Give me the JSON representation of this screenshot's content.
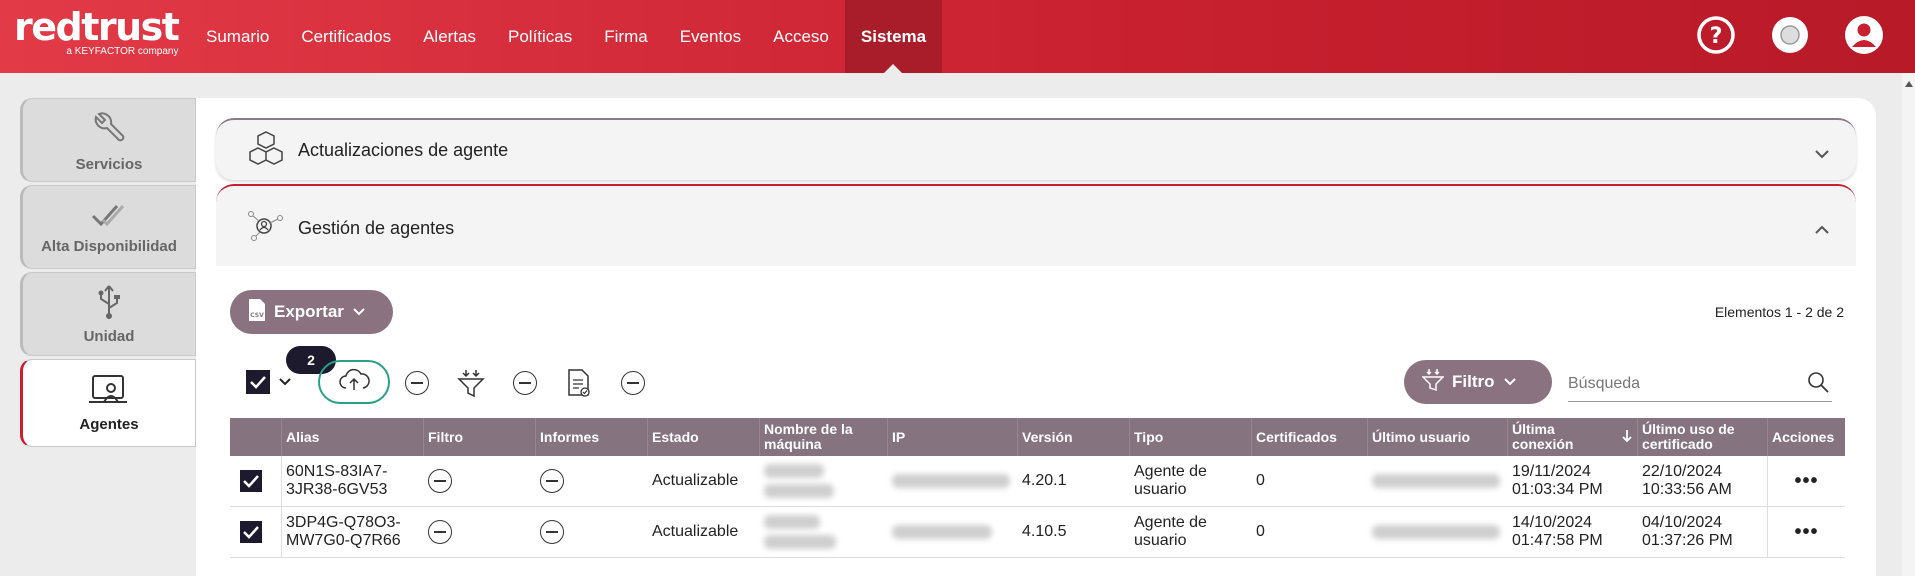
{
  "brand": {
    "name": "redtrust",
    "sub": "a KEYFACTOR company"
  },
  "nav": {
    "items": [
      "Sumario",
      "Certificados",
      "Alertas",
      "Políticas",
      "Firma",
      "Eventos",
      "Acceso",
      "Sistema"
    ],
    "active": "Sistema"
  },
  "top_icons": [
    "help-icon",
    "status-dot-icon",
    "user-icon"
  ],
  "sidebar": {
    "items": [
      {
        "label": "Servicios",
        "icon": "wrench-icon"
      },
      {
        "label": "Alta Disponibilidad",
        "icon": "double-check-icon"
      },
      {
        "label": "Unidad",
        "icon": "usb-icon"
      },
      {
        "label": "Agentes",
        "icon": "agent-monitor-icon",
        "active": true
      }
    ]
  },
  "accordions": {
    "updates": {
      "title": "Actualizaciones de agente"
    },
    "management": {
      "title": "Gestión de agentes"
    }
  },
  "toolbar": {
    "export_label": "Exportar",
    "elements_text": "Elementos 1 - 2 de 2",
    "selected_count": "2",
    "filter_label": "Filtro",
    "search_placeholder": "Búsqueda"
  },
  "table": {
    "headers": [
      "Alias",
      "Filtro",
      "Informes",
      "Estado",
      "Nombre de la máquina",
      "IP",
      "Versión",
      "Tipo",
      "Certificados",
      "Último usuario",
      "Última conexión",
      "Último uso de certificado",
      "Acciones"
    ],
    "rows": [
      {
        "alias": "60N1S-83IA7-3JR38-6GV53",
        "estado": "Actualizable",
        "version": "4.20.1",
        "tipo": "Agente de usuario",
        "certificados": "0",
        "ultima_conexion": "19/11/2024 01:03:34 PM",
        "ultimo_uso": "22/10/2024 10:33:56 AM"
      },
      {
        "alias": "3DP4G-Q78O3-MW7G0-Q7R66",
        "estado": "Actualizable",
        "version": "4.10.5",
        "tipo": "Agente de usuario",
        "certificados": "0",
        "ultima_conexion": "14/10/2024 01:47:58 PM",
        "ultimo_uso": "04/10/2024 01:37:26 PM"
      }
    ]
  },
  "colors": {
    "brand_red": "#c8202f",
    "accent_mauve": "#857380",
    "teal_focus": "#2aa08a"
  }
}
